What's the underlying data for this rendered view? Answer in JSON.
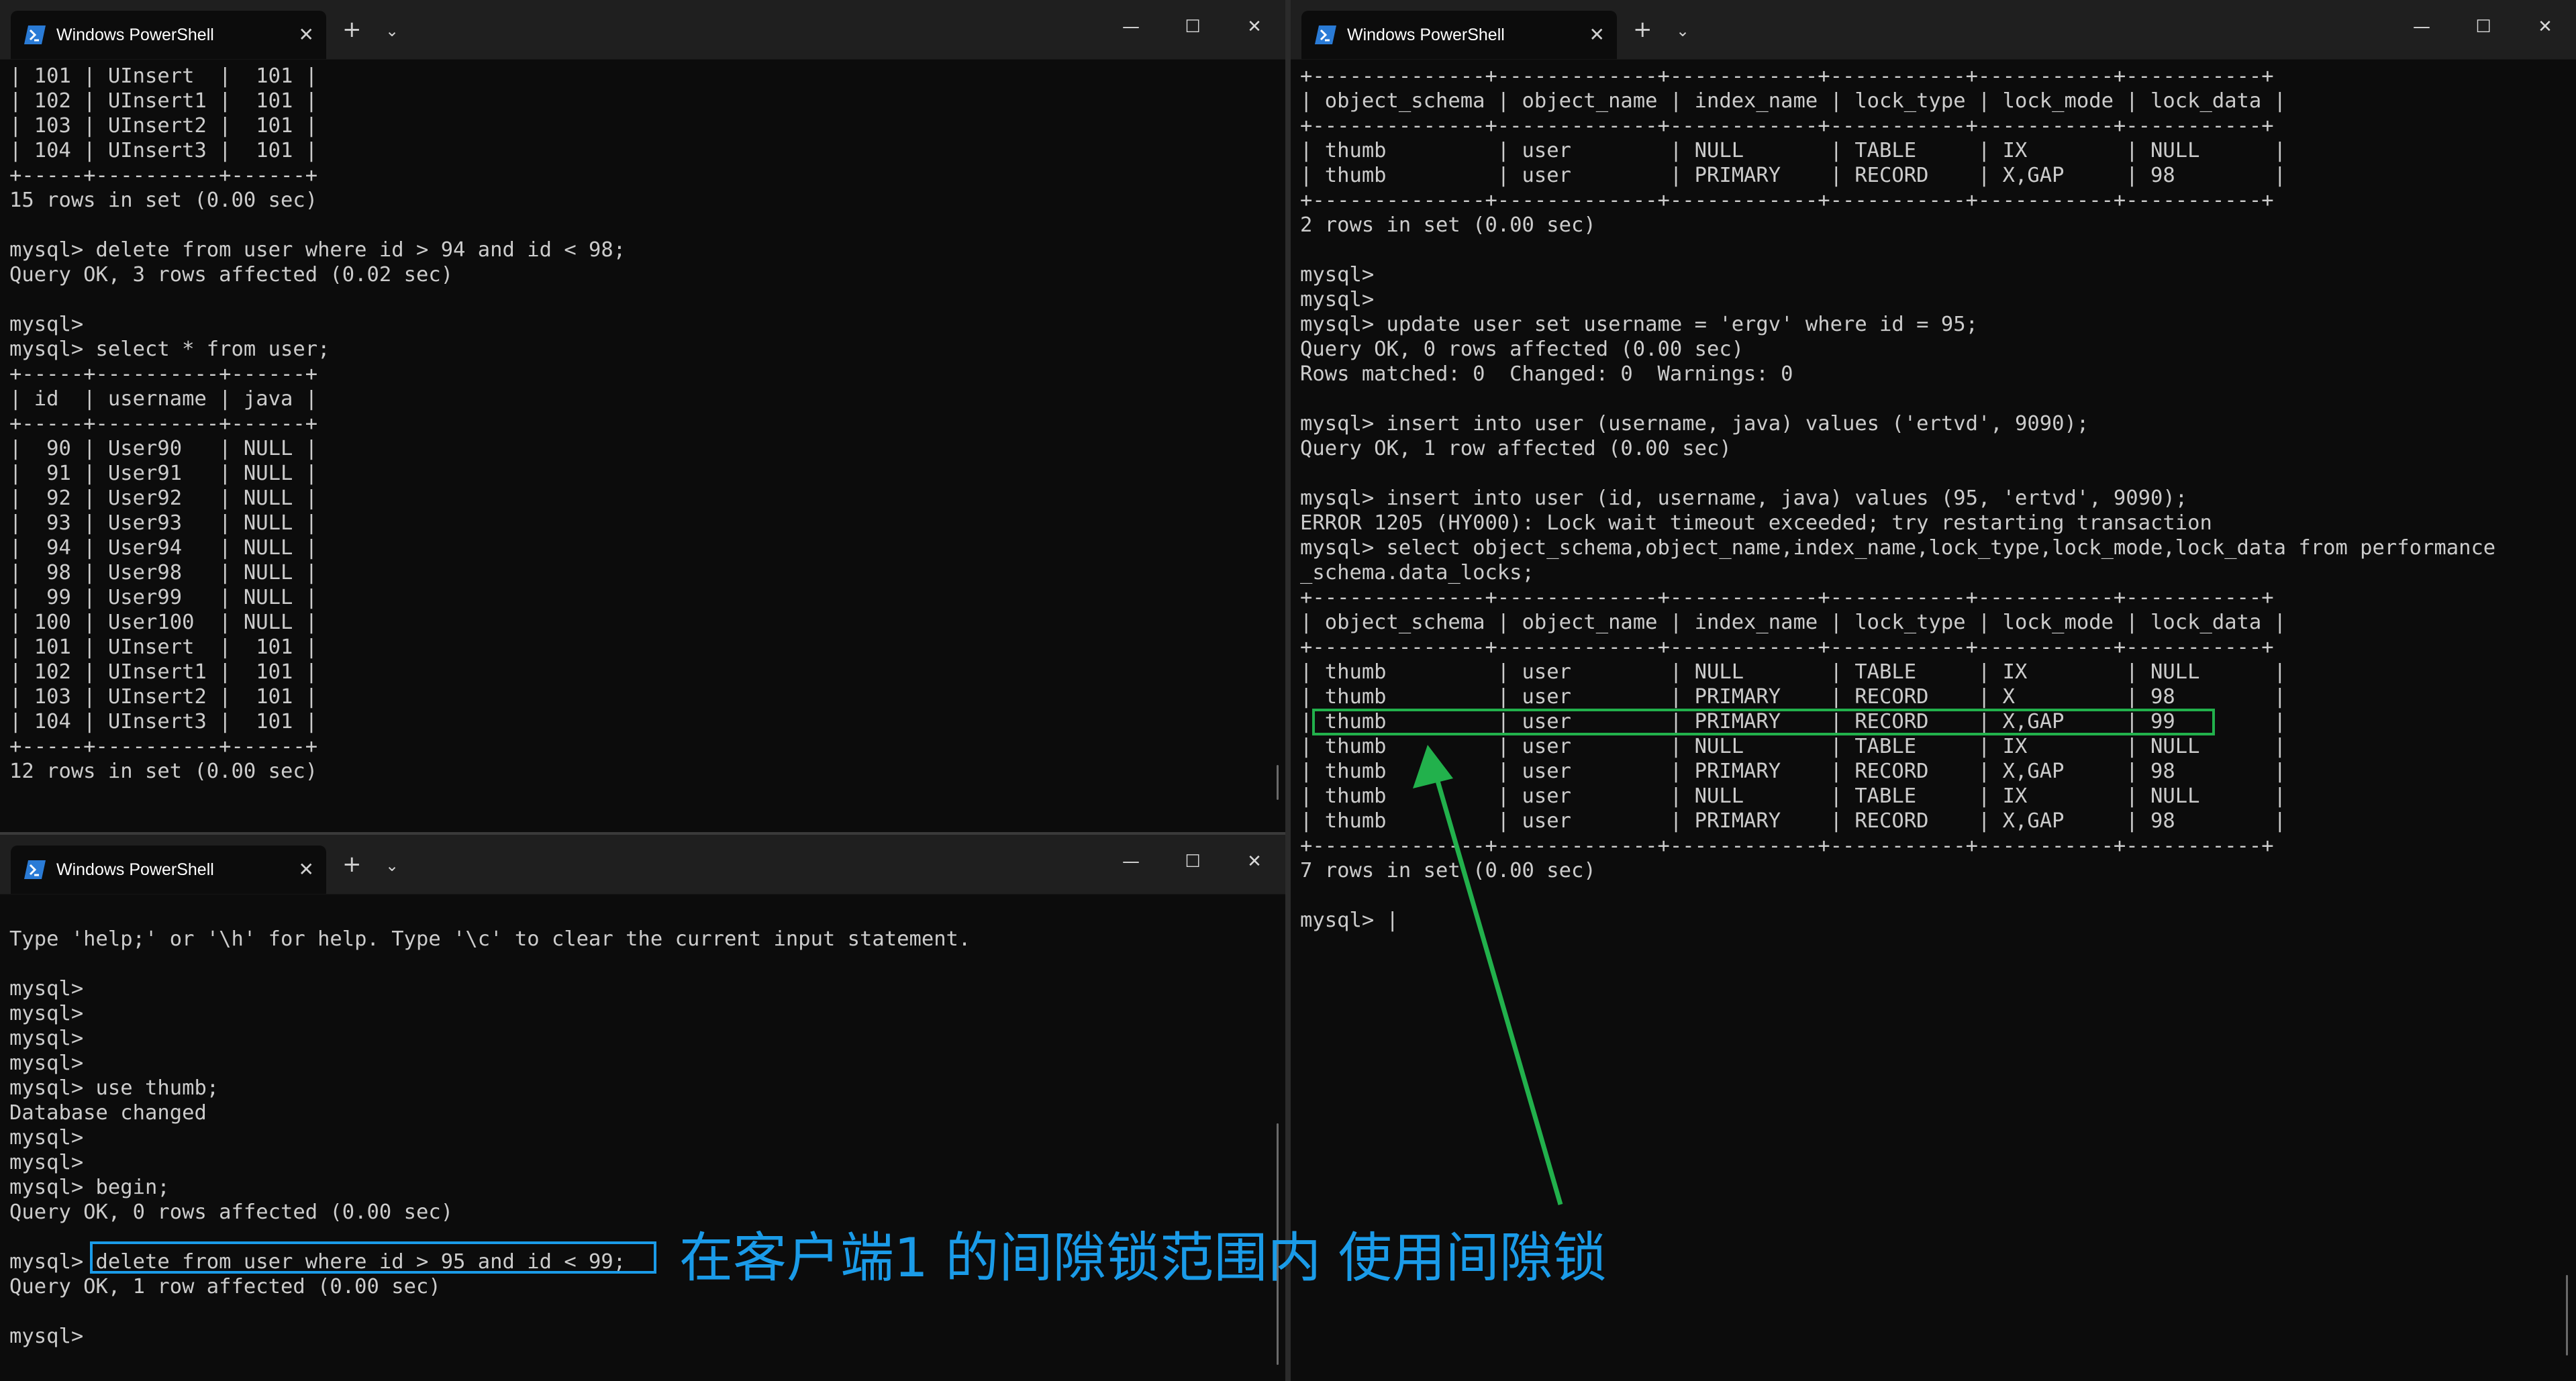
{
  "windows": [
    {
      "id": "top_left",
      "title": "Windows PowerShell",
      "lines": [
        "| 101 | UInsert  |  101 |",
        "| 102 | UInsert1 |  101 |",
        "| 103 | UInsert2 |  101 |",
        "| 104 | UInsert3 |  101 |",
        "+-----+----------+------+",
        "15 rows in set (0.00 sec)",
        "",
        "mysql> delete from user where id > 94 and id < 98;",
        "Query OK, 3 rows affected (0.02 sec)",
        "",
        "mysql>",
        "mysql> select * from user;",
        "+-----+----------+------+",
        "| id  | username | java |",
        "+-----+----------+------+",
        "|  90 | User90   | NULL |",
        "|  91 | User91   | NULL |",
        "|  92 | User92   | NULL |",
        "|  93 | User93   | NULL |",
        "|  94 | User94   | NULL |",
        "|  98 | User98   | NULL |",
        "|  99 | User99   | NULL |",
        "| 100 | User100  | NULL |",
        "| 101 | UInsert  |  101 |",
        "| 102 | UInsert1 |  101 |",
        "| 103 | UInsert2 |  101 |",
        "| 104 | UInsert3 |  101 |",
        "+-----+----------+------+",
        "12 rows in set (0.00 sec)"
      ]
    },
    {
      "id": "bottom_left",
      "title": "Windows PowerShell",
      "lines": [
        "",
        "Type 'help;' or '\\h' for help. Type '\\c' to clear the current input statement.",
        "",
        "mysql>",
        "mysql>",
        "mysql>",
        "mysql>",
        "mysql> use thumb;",
        "Database changed",
        "mysql>",
        "mysql>",
        "mysql> begin;",
        "Query OK, 0 rows affected (0.00 sec)",
        "",
        "mysql> delete from user where id > 95 and id < 99;",
        "Query OK, 1 row affected (0.00 sec)",
        "",
        "mysql>"
      ]
    },
    {
      "id": "right",
      "title": "Windows PowerShell",
      "lines": [
        "+--------------+-------------+------------+-----------+-----------+-----------+",
        "| object_schema | object_name | index_name | lock_type | lock_mode | lock_data |",
        "+--------------+-------------+------------+-----------+-----------+-----------+",
        "| thumb         | user        | NULL       | TABLE     | IX        | NULL      |",
        "| thumb         | user        | PRIMARY    | RECORD    | X,GAP     | 98        |",
        "+--------------+-------------+------------+-----------+-----------+-----------+",
        "2 rows in set (0.00 sec)",
        "",
        "mysql>",
        "mysql>",
        "mysql> update user set username = 'ergv' where id = 95;",
        "Query OK, 0 rows affected (0.00 sec)",
        "Rows matched: 0  Changed: 0  Warnings: 0",
        "",
        "mysql> insert into user (username, java) values ('ertvd', 9090);",
        "Query OK, 1 row affected (0.00 sec)",
        "",
        "mysql> insert into user (id, username, java) values (95, 'ertvd', 9090);",
        "ERROR 1205 (HY000): Lock wait timeout exceeded; try restarting transaction",
        "mysql> select object_schema,object_name,index_name,lock_type,lock_mode,lock_data from performance",
        "_schema.data_locks;",
        "+--------------+-------------+------------+-----------+-----------+-----------+",
        "| object_schema | object_name | index_name | lock_type | lock_mode | lock_data |",
        "+--------------+-------------+------------+-----------+-----------+-----------+",
        "| thumb         | user        | NULL       | TABLE     | IX        | NULL      |",
        "| thumb         | user        | PRIMARY    | RECORD    | X         | 98        |",
        "| thumb         | user        | PRIMARY    | RECORD    | X,GAP     | 99        |",
        "| thumb         | user        | NULL       | TABLE     | IX        | NULL      |",
        "| thumb         | user        | PRIMARY    | RECORD    | X,GAP     | 98        |",
        "| thumb         | user        | NULL       | TABLE     | IX        | NULL      |",
        "| thumb         | user        | PRIMARY    | RECORD    | X,GAP     | 98        |",
        "+--------------+-------------+------------+-----------+-----------+-----------+",
        "7 rows in set (0.00 sec)",
        "",
        "mysql> |"
      ]
    }
  ],
  "annotation": {
    "text": "在客户端1 的间隙锁范围内 使用间隙锁",
    "text_color": "#1a9be8",
    "box_color_blue": "#1a9be8",
    "box_color_green": "#22b14c"
  },
  "icons": {
    "tab_icon": "powershell-icon",
    "close": "close-icon",
    "new_tab": "plus-icon",
    "dropdown": "chevron-down-icon",
    "minimize": "minimize-icon",
    "maximize": "maximize-icon",
    "window_close": "window-close-icon"
  },
  "glyphs": {
    "close": "✕",
    "plus": "+",
    "chevron": "⌄",
    "minimize": "—",
    "maximize": "☐",
    "window_close": "✕"
  }
}
